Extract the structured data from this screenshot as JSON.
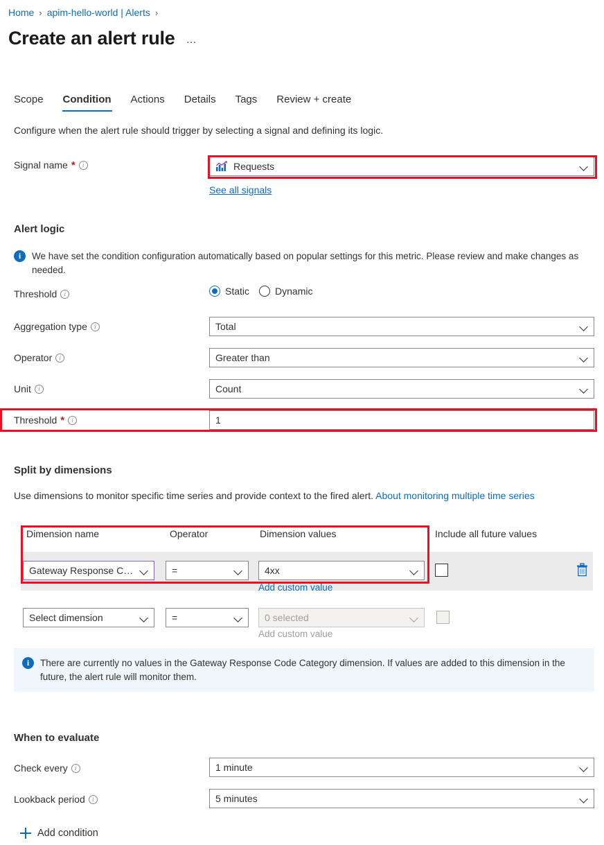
{
  "breadcrumb": {
    "items": [
      {
        "label": "Home"
      },
      {
        "label": "apim-hello-world | Alerts"
      }
    ],
    "separator": "›"
  },
  "header": {
    "title": "Create an alert rule",
    "more_label": "…"
  },
  "tabs": [
    {
      "label": "Scope",
      "active": false
    },
    {
      "label": "Condition",
      "active": true
    },
    {
      "label": "Actions",
      "active": false
    },
    {
      "label": "Details",
      "active": false
    },
    {
      "label": "Tags",
      "active": false
    },
    {
      "label": "Review + create",
      "active": false
    }
  ],
  "subtitle": "Configure when the alert rule should trigger by selecting a signal and defining its logic.",
  "signal": {
    "label": "Signal name",
    "required_marker": "*",
    "value": "Requests",
    "icon": "metrics-chart-icon",
    "see_all_link": "See all signals"
  },
  "alert_logic": {
    "heading": "Alert logic",
    "banner": "We have set the condition configuration automatically based on popular settings for this metric. Please review and make changes as needed.",
    "threshold_label": "Threshold",
    "threshold_options": [
      {
        "label": "Static",
        "selected": true
      },
      {
        "label": "Dynamic",
        "selected": false
      }
    ],
    "fields": [
      {
        "label": "Aggregation type",
        "value": "Total",
        "required": false
      },
      {
        "label": "Operator",
        "value": "Greater than",
        "required": false
      },
      {
        "label": "Unit",
        "value": "Count",
        "required": false
      }
    ],
    "threshold_value_label": "Threshold",
    "threshold_value": "1"
  },
  "split_dimensions": {
    "heading": "Split by dimensions",
    "description": "Use dimensions to monitor specific time series and provide context to the fired alert.",
    "description_link": "About monitoring multiple time series",
    "headers": {
      "name": "Dimension name",
      "operator": "Operator",
      "values": "Dimension values",
      "future": "Include all future values"
    },
    "rows": [
      {
        "name": "Gateway Response Co...",
        "operator": "=",
        "values": "4xx",
        "add_custom": "Add custom value",
        "include_future": false,
        "disabled": false,
        "delete_icon": "trash-icon"
      },
      {
        "name": "Select dimension",
        "operator": "=",
        "values": "0 selected",
        "add_custom": "Add custom value",
        "include_future": false,
        "disabled": true
      }
    ],
    "notice": "There are currently no values in the Gateway Response Code Category dimension. If values are added to this dimension in the future, the alert rule will monitor them."
  },
  "when_to_evaluate": {
    "heading": "When to evaluate",
    "fields": [
      {
        "label": "Check every",
        "value": "1 minute"
      },
      {
        "label": "Lookback period",
        "value": "5 minutes"
      }
    ]
  },
  "add_condition": "Add condition",
  "colors": {
    "accent_blue": "#0f6cbd",
    "highlight_red": "#e81123",
    "focus_purple": "#8764b8",
    "required_red": "#a4262c",
    "banner_bg": "#eff6fc",
    "row_bg": "#ebebeb"
  }
}
